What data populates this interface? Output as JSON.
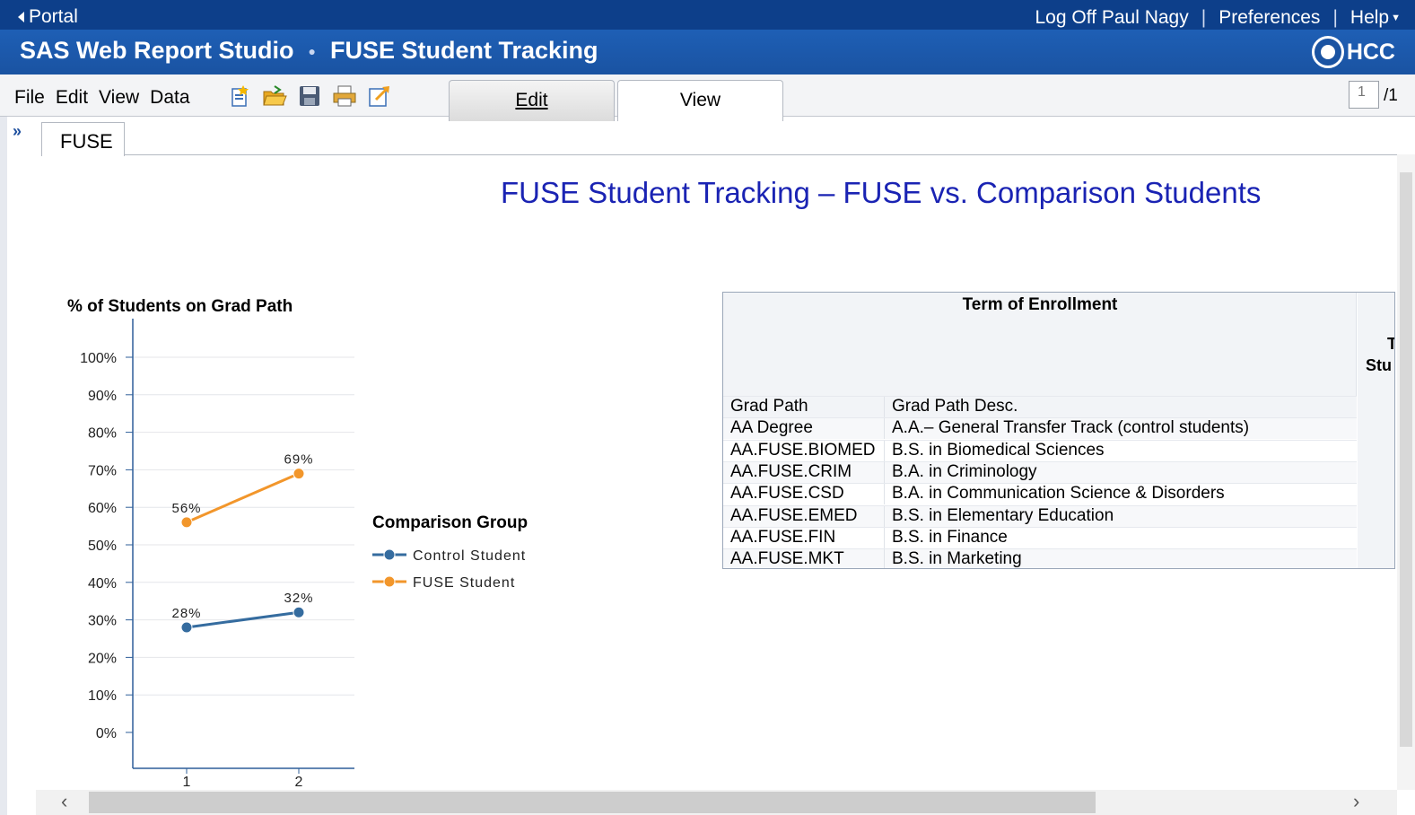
{
  "topbar": {
    "portal_label": "Portal",
    "logoff_label": "Log Off Paul Nagy",
    "preferences_label": "Preferences",
    "help_label": "Help",
    "separator": "|"
  },
  "titlebar": {
    "app_name": "SAS Web Report Studio",
    "report_name": "FUSE Student Tracking",
    "logo_text": "HCC"
  },
  "menubar": {
    "file": "File",
    "edit": "Edit",
    "view": "View",
    "data": "Data"
  },
  "mode_tabs": {
    "edit": "Edit",
    "view": "View"
  },
  "pager": {
    "current": "1",
    "total": "/1"
  },
  "section_tab": "FUSE",
  "report_title": "FUSE Student Tracking – FUSE vs. Comparison Students",
  "chart_data": {
    "type": "line",
    "title": "% of Students on Grad Path",
    "xlabel": "",
    "ylabel": "",
    "x": [
      1,
      2
    ],
    "ylim": [
      0,
      100
    ],
    "yticks": [
      "0%",
      "10%",
      "20%",
      "30%",
      "40%",
      "50%",
      "60%",
      "70%",
      "80%",
      "90%",
      "100%"
    ],
    "grid": true,
    "legend_title": "Comparison Group",
    "legend_position": "right",
    "series": [
      {
        "name": "Control Student",
        "values": [
          28,
          32
        ],
        "labels": [
          "28%",
          "32%"
        ],
        "color": "#356c9f"
      },
      {
        "name": "FUSE Student",
        "values": [
          56,
          69
        ],
        "labels": [
          "56%",
          "69%"
        ],
        "color": "#f2962b"
      }
    ]
  },
  "crosstab": {
    "header": "Term of Enrollment",
    "side_header_line1": "T",
    "side_header_line2": "Stu",
    "columns": [
      "Grad Path",
      "Grad Path Desc."
    ],
    "rows": [
      [
        "AA Degree",
        "A.A.– General Transfer Track (control students)"
      ],
      [
        "AA.FUSE.BIOMED",
        "B.S. in Biomedical Sciences"
      ],
      [
        "AA.FUSE.CRIM",
        "B.A. in Criminology"
      ],
      [
        "AA.FUSE.CSD",
        "B.A. in Communication Science & Disorders"
      ],
      [
        "AA.FUSE.EMED",
        "B.S. in Elementary Education"
      ],
      [
        "AA.FUSE.FIN",
        "B.S. in Finance"
      ],
      [
        "AA.FUSE.MKT",
        "B.S. in Marketing"
      ]
    ]
  }
}
